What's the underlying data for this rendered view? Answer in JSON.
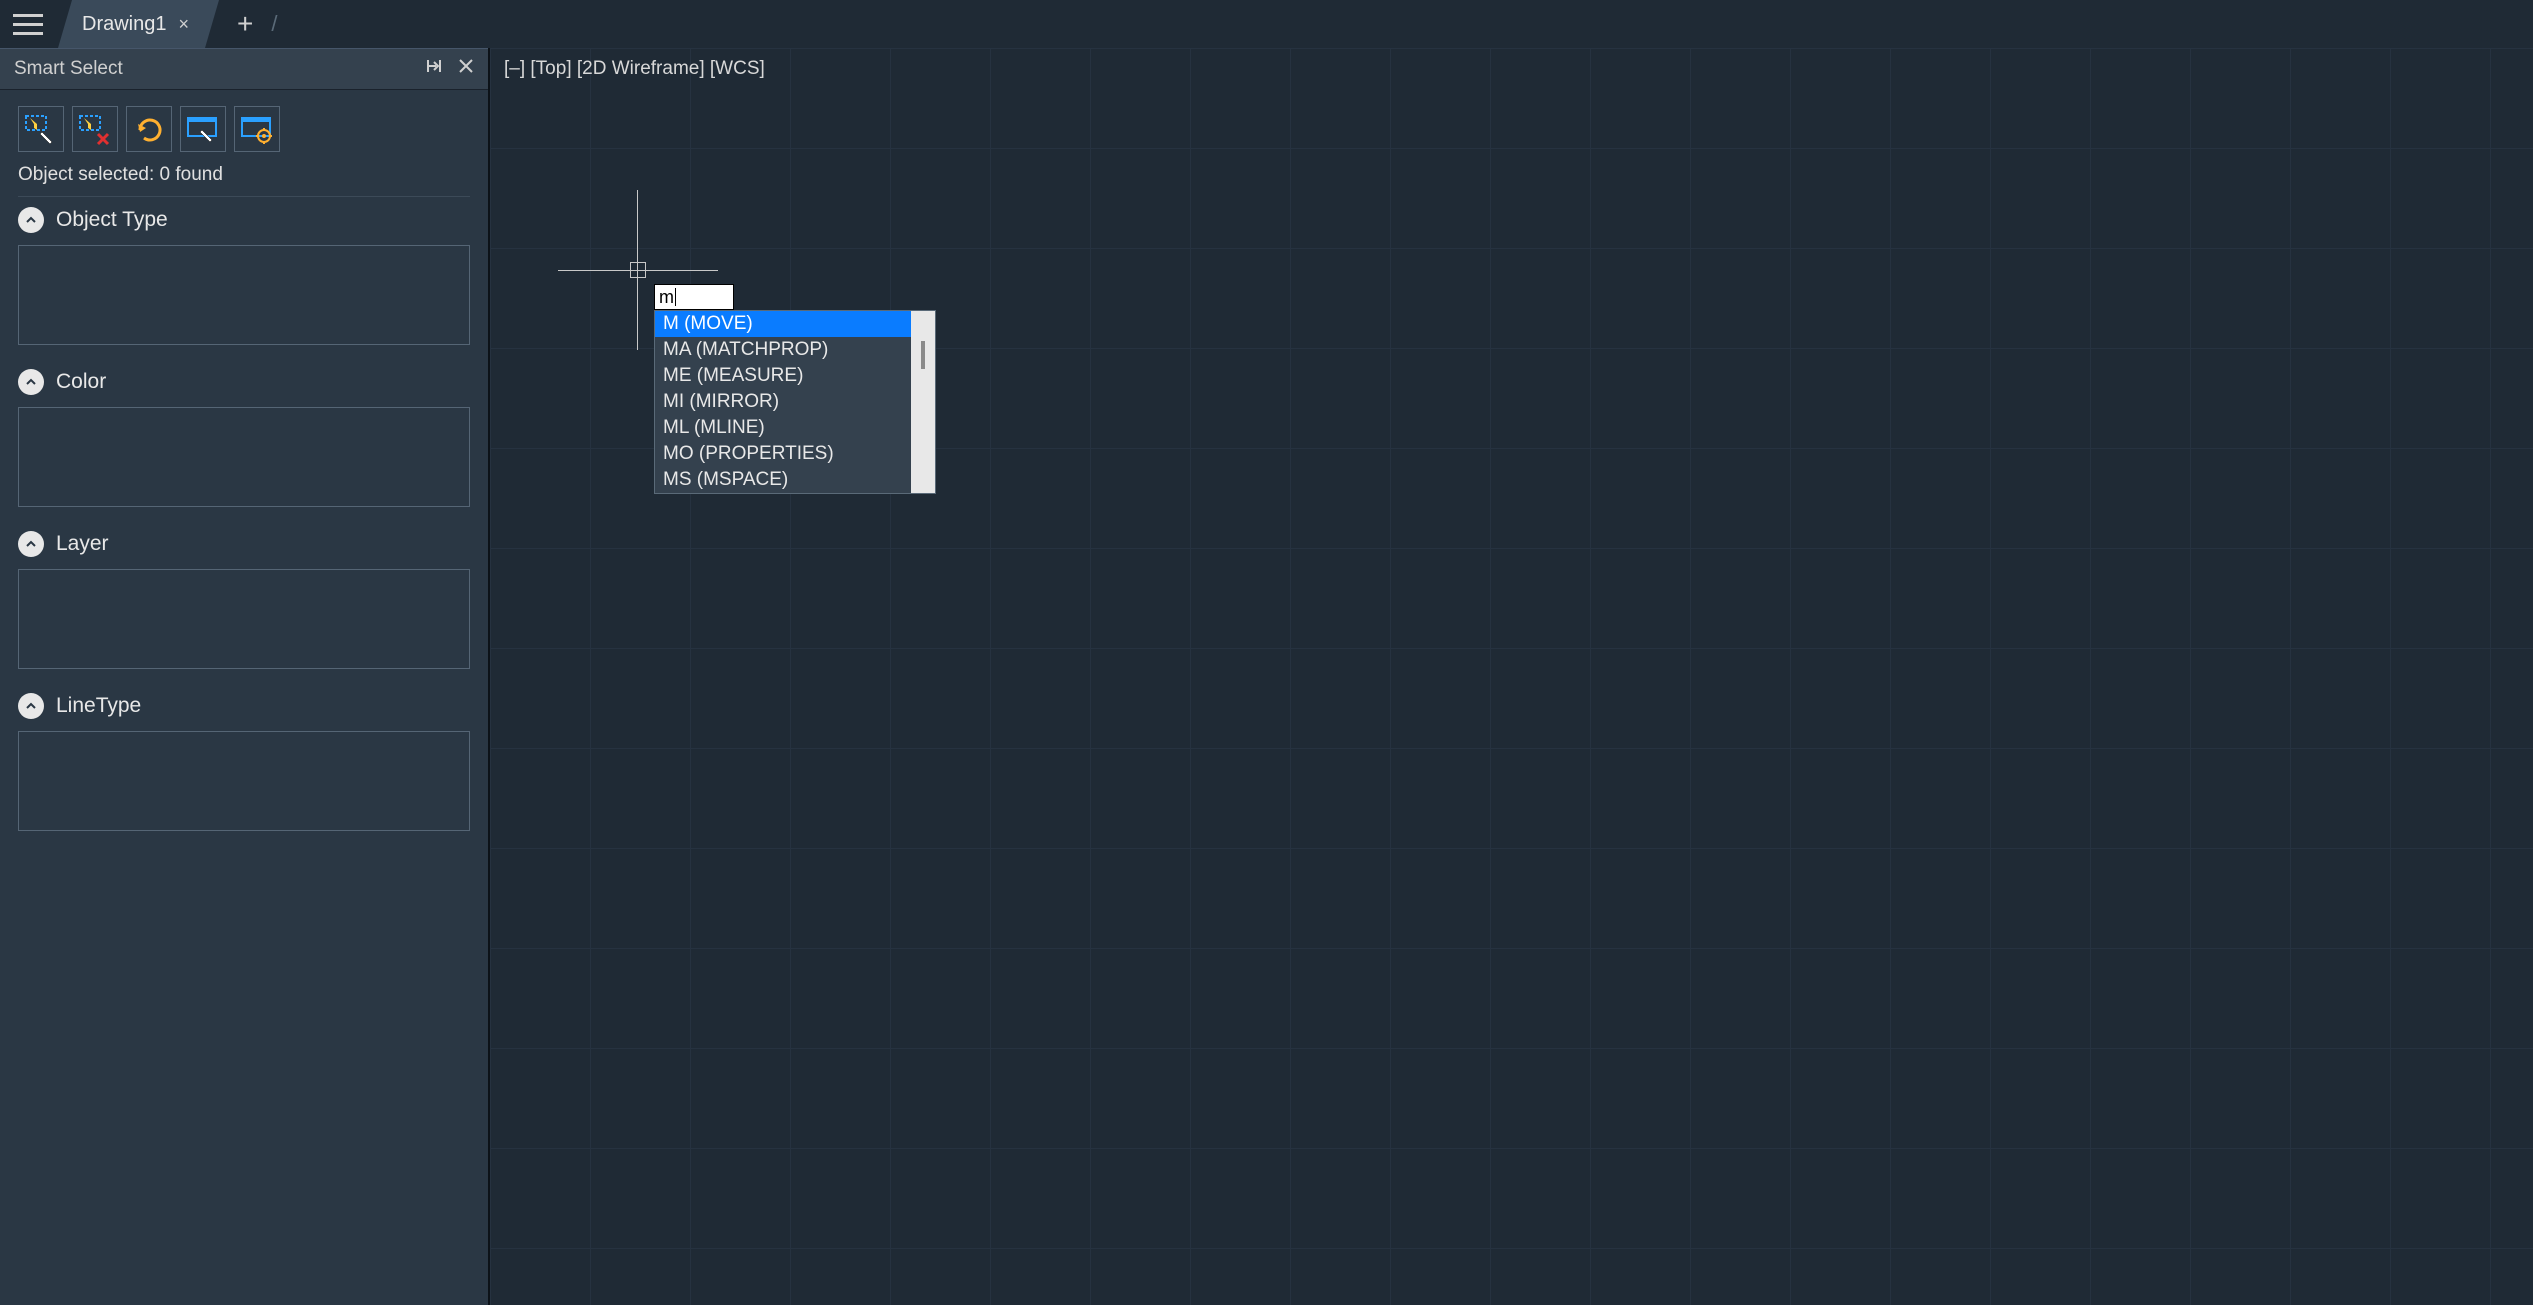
{
  "tabs": {
    "active_label": "Drawing1"
  },
  "sidebar": {
    "title": "Smart Select",
    "status": "Object selected: 0 found",
    "sections": [
      {
        "label": "Object Type"
      },
      {
        "label": "Color"
      },
      {
        "label": "Layer"
      },
      {
        "label": "LineType"
      }
    ],
    "toolbar_icons": [
      "filter-select-icon",
      "filter-clear-icon",
      "refresh-icon",
      "pick-on-screen-icon",
      "settings-icon"
    ]
  },
  "viewport": {
    "label": "[–] [Top] [2D Wireframe] [WCS]"
  },
  "command_input": {
    "value": "m"
  },
  "autocomplete": {
    "items": [
      "M (MOVE)",
      "MA (MATCHPROP)",
      "ME (MEASURE)",
      "MI (MIRROR)",
      "ML (MLINE)",
      "MO (PROPERTIES)",
      "MS (MSPACE)"
    ],
    "selected_index": 0
  }
}
